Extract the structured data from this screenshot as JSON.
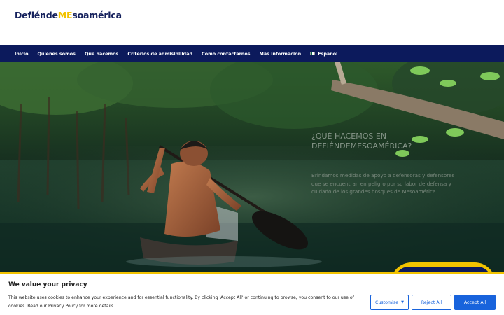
{
  "header": {
    "logo_prefix": "Defiénde",
    "logo_accent": "ME",
    "logo_suffix": "soamérica",
    "brand_color": "#0c1a5c",
    "accent_color": "#f2c300"
  },
  "nav": {
    "items": [
      {
        "label": "Inicio"
      },
      {
        "label": "Quiénes somos"
      },
      {
        "label": "Qué hacemos"
      },
      {
        "label": "Criterios de admisibilidad"
      },
      {
        "label": "Cómo contactarnos"
      },
      {
        "label": "Más información"
      },
      {
        "label": "Español",
        "icon": "mexico-flag-icon"
      }
    ]
  },
  "hero": {
    "heading": "¿Qué hacemos en DefiéndeMEsoamérica?",
    "text": "Brindamos medidas de apoyo a defensoras y defensores que se encuentran en peligro por su labor de defensa y cuidado de los grandes bosques de Mesoamérica"
  },
  "cookie": {
    "title": "We value your privacy",
    "text": "This website uses cookies to enhance your experience and for essential functionality. By clicking 'Accept All' or continuing to browse, you consent to our use of cookies. Read our Privacy Policy for more details.",
    "customise_label": "Customise",
    "reject_label": "Reject All",
    "accept_label": "Accept All",
    "button_color": "#1863dc"
  }
}
